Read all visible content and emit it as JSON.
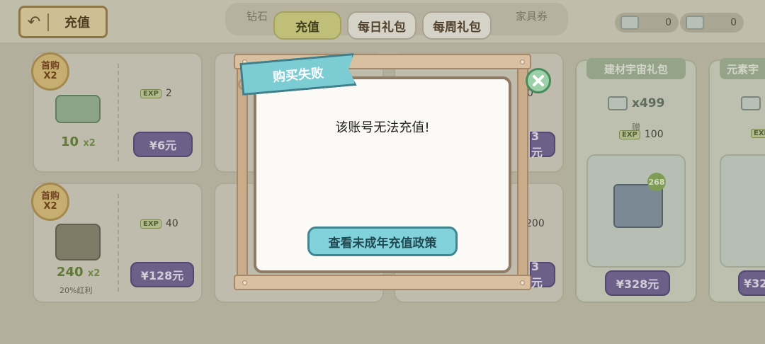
{
  "header": {
    "back_label": "充值",
    "ghost_left": "钻石",
    "ghost_right": "家具券",
    "tabs": [
      {
        "label": "充值",
        "active": true
      },
      {
        "label": "每日礼包",
        "active": false
      },
      {
        "label": "每周礼包",
        "active": false
      }
    ],
    "currency_1": "0",
    "currency_2": "0"
  },
  "cards": [
    {
      "badge_line1": "首购",
      "badge_line2": "X2",
      "qty": "10",
      "qty_mult": "x2",
      "exp_tag": "EXP",
      "exp": "2",
      "price": "¥6元"
    },
    {
      "badge_line1": "首购",
      "badge_line2": "X2",
      "qty": "240",
      "qty_mult": "x2",
      "bonus": "20%红利",
      "exp_tag": "EXP",
      "exp": "40",
      "price": "¥128元"
    }
  ],
  "hidden_cards": [
    {
      "exp": "0",
      "price": "3元"
    },
    {
      "exp": "200",
      "price": "3元"
    }
  ],
  "gift_packs": [
    {
      "title": "建材宇宙礼包",
      "qty": "x499",
      "zeng": "赠",
      "exp_tag": "EXP",
      "exp": "100",
      "count": "268",
      "price": "¥328元"
    },
    {
      "title": "元素宇",
      "exp_tag": "EXP",
      "price": "¥32"
    }
  ],
  "dialog": {
    "title": "购买失败",
    "message": "该账号无法充值!",
    "button_label": "查看未成年充值政策"
  },
  "colors": {
    "dialog_title_bg": "#7cccd4",
    "dialog_button_bg": "#82d2dc",
    "price_button_bg": "#7a6b9a"
  }
}
